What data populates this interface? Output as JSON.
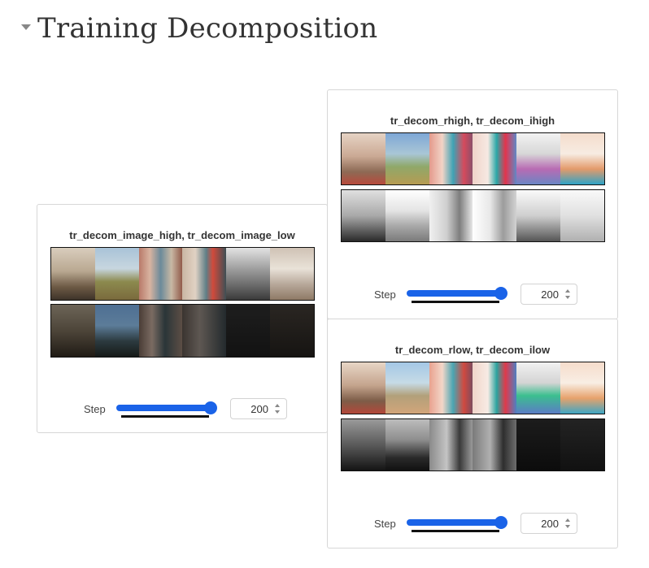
{
  "section": {
    "title": "Training Decomposition",
    "caret_icon": "caret-down-icon"
  },
  "cards": {
    "image": {
      "title": "tr_decom_image_high, tr_decom_image_low",
      "step_label": "Step",
      "step_value": "200"
    },
    "reflect_high": {
      "title": "tr_decom_rhigh, tr_decom_ihigh",
      "step_label": "Step",
      "step_value": "200"
    },
    "reflect_low": {
      "title": "tr_decom_rlow, tr_decom_ilow",
      "step_label": "Step",
      "step_value": "200"
    }
  },
  "colors": {
    "accent": "#1a63e8",
    "border": "#d7d7d7"
  }
}
